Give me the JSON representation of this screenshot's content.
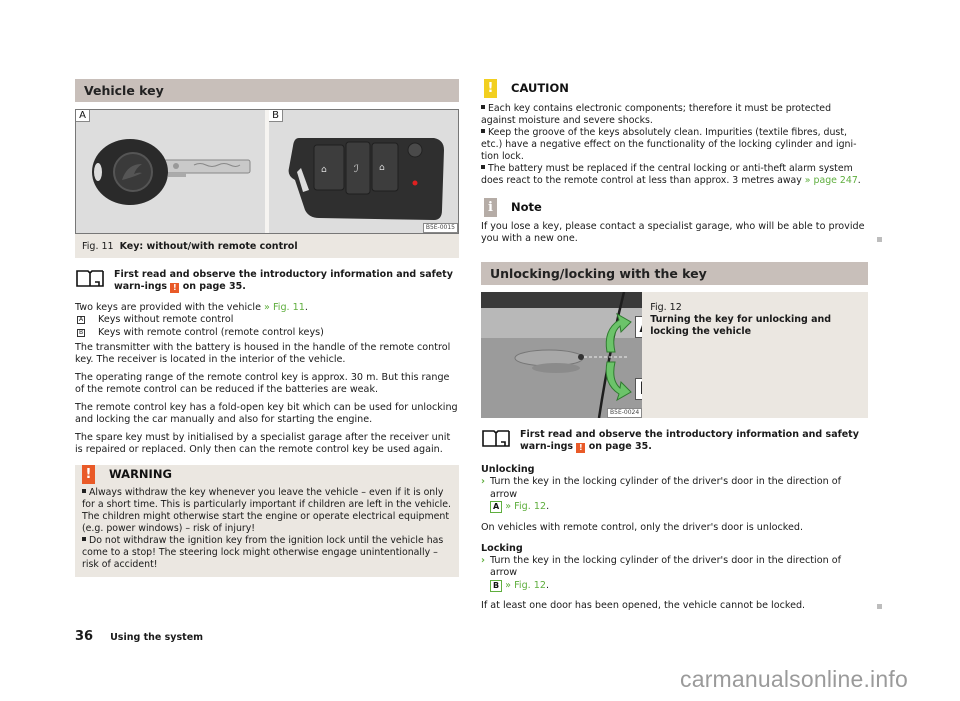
{
  "left": {
    "section_title": "Vehicle key",
    "figure": {
      "panel_a_label": "A",
      "panel_b_label": "B",
      "image_code": "B5E-0015",
      "number": "Fig. 11",
      "caption": "Key: without/with remote control"
    },
    "read_first": {
      "text_before": "First read and observe the introductory information and safety warn-ings",
      "warning_icon": "!",
      "text_after": "on page 35."
    },
    "intro": {
      "text": "Two keys are provided with the vehicle",
      "link": "» Fig. 11",
      "tail": "."
    },
    "key_types": [
      {
        "tag": "A",
        "text": "Keys without remote control"
      },
      {
        "tag": "B",
        "text": "Keys with remote control (remote control keys)"
      }
    ],
    "paragraphs": [
      "The transmitter with the battery is housed in the handle of the remote control key. The receiver is located in the interior of the vehicle.",
      "The operating range of the remote control key is approx. 30 m. But this range of the remote control can be reduced if the batteries are weak.",
      "The remote control key has a fold-open key bit which can be used for unlocking and locking the car manually and also for starting the engine.",
      "The spare key must by initialised by a specialist garage after the receiver unit is repaired or replaced. Only then can the remote control key be used again."
    ],
    "warning": {
      "icon": "!",
      "icon_color": "#e95a28",
      "title": "WARNING",
      "items": [
        "Always withdraw the key whenever you leave the vehicle – even if it is only for a short time. This is particularly important if children are left in the vehicle. The children might otherwise start the engine or operate electrical equipment (e.g. power windows) – risk of injury!",
        "Do not withdraw the ignition key from the ignition lock until the vehicle has come to a stop! The steering lock might otherwise engage unintentionally – risk of accident!"
      ]
    }
  },
  "right": {
    "caution": {
      "icon": "!",
      "icon_color": "#f2cf1f",
      "title": "CAUTION",
      "items": [
        {
          "text": "Each key contains electronic components; therefore it must be protected against moisture and severe shocks."
        },
        {
          "text": "Keep the groove of the keys absolutely clean. Impurities (textile fibres, dust, etc.) have a negative effect on the functionality of the locking cylinder and igni-tion lock."
        },
        {
          "text": "The battery must be replaced if the central locking or anti-theft alarm system does react to the remote control at less than approx. 3 metres away",
          "link": "» page 247",
          "tail": "."
        }
      ]
    },
    "note": {
      "icon": "i",
      "icon_color": "#b5aca6",
      "title": "Note",
      "text": "If you lose a key, please contact a specialist garage, who will be able to provide you with a new one."
    },
    "section_title": "Unlocking/locking with the key",
    "figure": {
      "image_code": "B5E-0024",
      "label_a": "A",
      "label_b": "B",
      "number": "Fig. 12",
      "caption": "Turning the key for unlocking and locking the vehicle"
    },
    "read_first": {
      "text_before": "First read and observe the introductory information and safety warn-ings",
      "warning_icon": "!",
      "text_after": "on page 35."
    },
    "unlocking": {
      "heading": "Unlocking",
      "step": "Turn the key in the locking cylinder of the driver's door in the direction of arrow",
      "tag": "A",
      "link": "» Fig. 12",
      "tail": ".",
      "note": "On vehicles with remote control, only the driver's door is unlocked."
    },
    "locking": {
      "heading": "Locking",
      "step": "Turn the key in the locking cylinder of the driver's door in the direction of arrow",
      "tag": "B",
      "link": "» Fig. 12",
      "tail": ".",
      "note": "If at least one door has been opened, the vehicle cannot be locked."
    }
  },
  "footer": {
    "page_number": "36",
    "chapter": "Using the system"
  },
  "watermark": "carmanualsonline.info"
}
